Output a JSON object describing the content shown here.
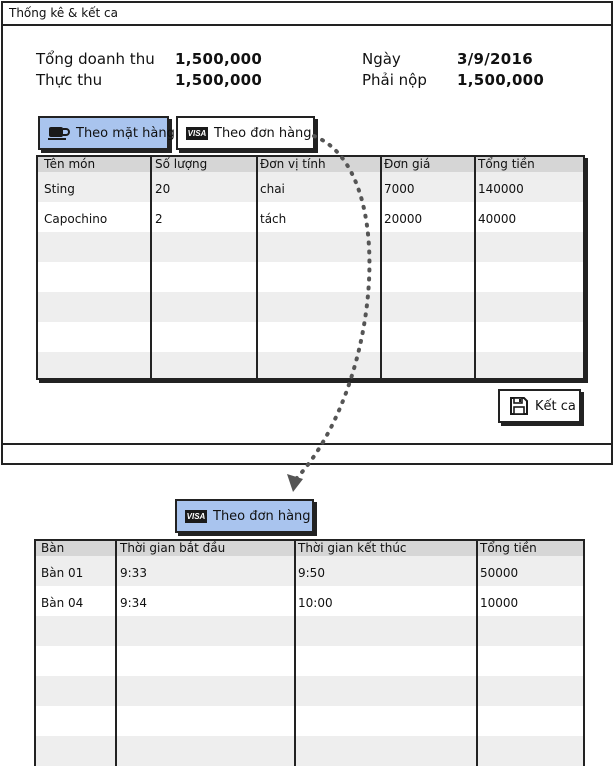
{
  "window": {
    "title": "Thống kê & kết ca"
  },
  "summary": {
    "revenue_label": "Tổng doanh thu",
    "revenue_value": "1,500,000",
    "actual_label": "Thực thu",
    "actual_value": "1,500,000",
    "date_label": "Ngày",
    "date_value": "3/9/2016",
    "payable_label": "Phải nộp",
    "payable_value": "1,500,000"
  },
  "tabs": {
    "by_item": "Theo mặt hàng",
    "by_order": "Theo đơn hàng"
  },
  "items_table": {
    "headers": [
      "Tên món",
      "Số lượng",
      "Đơn vị tính",
      "Đơn giá",
      "Tổng tiền"
    ],
    "rows": [
      [
        "Sting",
        "20",
        "chai",
        "7000",
        "140000"
      ],
      [
        "Capochino",
        "2",
        "tách",
        "20000",
        "40000"
      ]
    ]
  },
  "close_shift_button": {
    "label": "Kết ca",
    "icon": "save-icon"
  },
  "order_view": {
    "tab_label": "Theo đơn hàng",
    "headers": [
      "Bàn",
      "Thời gian bắt đầu",
      "Thời gian kết thúc",
      "Tổng tiền"
    ],
    "rows": [
      [
        "Bàn 01",
        "9:33",
        "9:50",
        "50000"
      ],
      [
        "Bàn 04",
        "9:34",
        "10:00",
        "10000"
      ]
    ]
  },
  "colors": {
    "active_tab": "#a9c4ee",
    "header_row": "#d6d6d6",
    "stripe_row": "#eeeeee",
    "border": "#222222"
  }
}
